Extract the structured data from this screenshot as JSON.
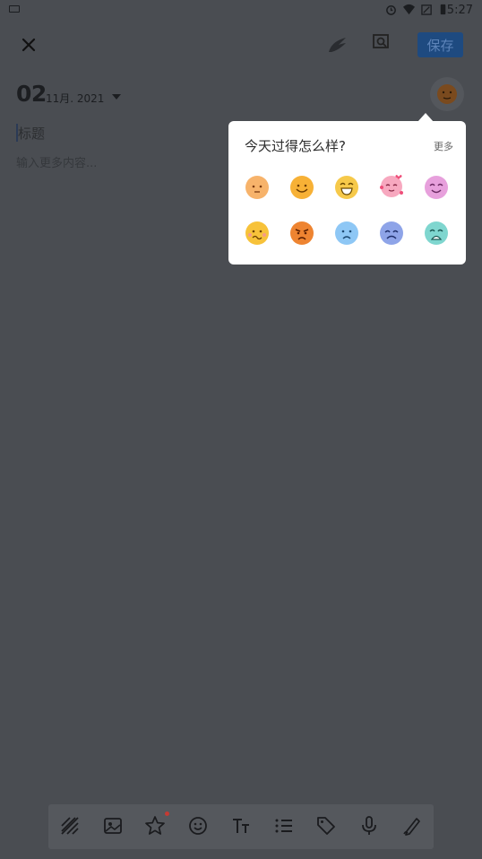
{
  "status_bar": {
    "time": "5:27"
  },
  "top_bar": {
    "save_label": "保存"
  },
  "date": {
    "day": "02",
    "month_year": "11月. 2021"
  },
  "editor": {
    "title_placeholder": "标题",
    "body_placeholder": "输入更多内容..."
  },
  "mood_popup": {
    "title": "今天过得怎么样?",
    "more_label": "更多",
    "moods": [
      {
        "name": "calm",
        "color": "#f7b36b"
      },
      {
        "name": "happy",
        "color": "#f7b136"
      },
      {
        "name": "grin",
        "color": "#f6c94a"
      },
      {
        "name": "in-love",
        "color": "#f7a8bf"
      },
      {
        "name": "content",
        "color": "#e7a0dc"
      },
      {
        "name": "worried",
        "color": "#f7c23a"
      },
      {
        "name": "angry",
        "color": "#ee8431"
      },
      {
        "name": "sad",
        "color": "#8ec7f5"
      },
      {
        "name": "upset",
        "color": "#8ea4e8"
      },
      {
        "name": "crying",
        "color": "#7fd6cf"
      }
    ]
  },
  "toolbar": {
    "tools": [
      "texture",
      "image",
      "sticker",
      "emoji",
      "text-format",
      "list",
      "tag",
      "microphone",
      "handwriting"
    ]
  },
  "colors": {
    "overlay": "#4a4d52",
    "save_button": "#1e4a80",
    "toolbar": "#55585d",
    "badge": "#c43a33"
  }
}
